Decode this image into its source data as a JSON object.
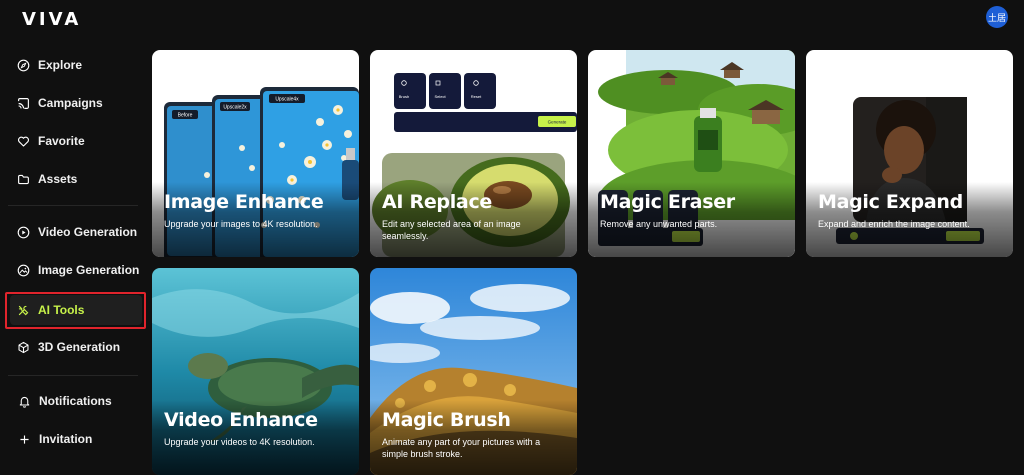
{
  "header": {
    "logo": "VIVA",
    "avatar_text": "土居"
  },
  "sidebar": {
    "items": [
      {
        "label": "Explore",
        "icon": "compass-icon"
      },
      {
        "label": "Campaigns",
        "icon": "cast-icon"
      },
      {
        "label": "Favorite",
        "icon": "heart-icon"
      },
      {
        "label": "Assets",
        "icon": "folder-icon"
      },
      {
        "label": "Video Generation",
        "icon": "play-circle-icon"
      },
      {
        "label": "Image Generation",
        "icon": "image-circle-icon"
      },
      {
        "label": "AI Tools",
        "icon": "tools-icon",
        "active": true
      },
      {
        "label": "3D Generation",
        "icon": "cube-icon"
      },
      {
        "label": "Notifications",
        "icon": "bell-icon"
      },
      {
        "label": "Invitation",
        "icon": "plus-icon"
      }
    ],
    "accent_color": "#c7f24a",
    "highlight_outline_color": "#e0242c"
  },
  "tools": [
    {
      "title": "Image Enhance",
      "description": "Upgrade your images to 4K resolution.",
      "art_labels": {
        "before": "Before",
        "upscale_2x": "Upscale2x",
        "upscale_4x": "Upscale4x"
      }
    },
    {
      "title": "AI Replace",
      "description": "Edit any selected area of an image seamlessly.",
      "art_labels": {
        "brush": "Brush",
        "select": "Select",
        "reset": "Reset",
        "generate": "Generate"
      }
    },
    {
      "title": "Magic Eraser",
      "description": "Remove any unwanted parts."
    },
    {
      "title": "Magic Expand",
      "description": "Expand and enrich the image content."
    },
    {
      "title": "Video Enhance",
      "description": "Upgrade your videos to 4K resolution."
    },
    {
      "title": "Magic Brush",
      "description": "Animate any part of your pictures with a simple brush stroke."
    }
  ]
}
